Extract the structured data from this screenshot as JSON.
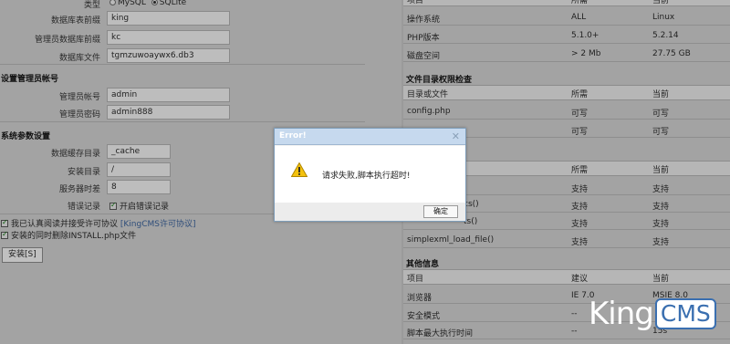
{
  "form": {
    "db_type": {
      "label": "类型",
      "options": [
        "MySQL",
        "SQLite"
      ],
      "selected": "SQLite"
    },
    "table_prefix": {
      "label": "数据库表前缀",
      "value": "king"
    },
    "admin_prefix": {
      "label": "管理员数据库前缀",
      "value": "kc"
    },
    "db_file": {
      "label": "数据库文件",
      "value": "tgmzuwoaywx6.db3"
    },
    "admin_section_title": "设置管理员帐号",
    "admin_account": {
      "label": "管理员帐号",
      "value": "admin"
    },
    "admin_password": {
      "label": "管理员密码",
      "value": "admin888"
    },
    "sys_section_title": "系统参数设置",
    "cache_dir": {
      "label": "数据缓存目录",
      "value": "_cache"
    },
    "install_dir": {
      "label": "安装目录",
      "value": "/"
    },
    "timezone": {
      "label": "服务器时差",
      "value": "8"
    },
    "error_log": {
      "label": "错误记录",
      "checkbox_label": "开启错误记录"
    },
    "agree_text": "我已认真阅读并接受许可协议",
    "agree_link": "[KingCMS许可协议]",
    "delete_install_text": "安装的同时删除INSTALL.php文件",
    "install_button": "安装[S]"
  },
  "env": {
    "header": [
      "项目",
      "所需",
      "当前"
    ],
    "rows": [
      [
        "操作系统",
        "ALL",
        "Linux"
      ],
      [
        "PHP版本",
        "5.1.0+",
        "5.2.14"
      ],
      [
        "磁盘空间",
        "> 2 Mb",
        "27.75 GB"
      ]
    ]
  },
  "perms": {
    "title": "文件目录权限检查",
    "header": [
      "目录或文件",
      "所需",
      "当前"
    ],
    "rows": [
      [
        "config.php",
        "可写",
        "可写"
      ],
      [
        "",
        "可写",
        "可写"
      ]
    ]
  },
  "funcs": {
    "header": [
      "",
      "所需",
      "当前"
    ],
    "rows": [
      [
        "",
        "支持",
        "支持"
      ],
      [
        "cs()",
        "支持",
        "支持"
      ],
      [
        "ts()",
        "支持",
        "支持"
      ],
      [
        "simplexml_load_file()",
        "支持",
        "支持"
      ]
    ]
  },
  "other": {
    "title": "其他信息",
    "header": [
      "项目",
      "建议",
      "当前"
    ],
    "rows": [
      [
        "浏览器",
        "IE 7.0",
        "MSIE 8.0"
      ],
      [
        "安全模式",
        "--",
        ""
      ],
      [
        "脚本最大执行时间",
        "--",
        "15s"
      ]
    ]
  },
  "dialog": {
    "title": "Error!",
    "message": "请求失败,脚本执行超时!",
    "ok_label": "确定"
  },
  "brand": {
    "part1": "King",
    "part2": "CMS",
    "accent": "#3a6fb0"
  }
}
